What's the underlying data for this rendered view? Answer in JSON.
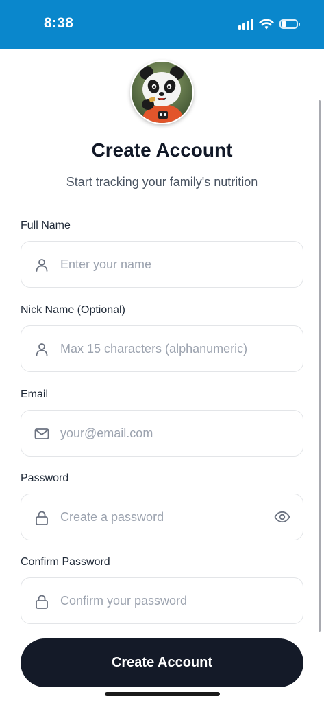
{
  "status_bar": {
    "time": "8:38",
    "icons": [
      "cellular-signal-icon",
      "wifi-icon",
      "battery-icon"
    ],
    "battery_level": 0.35,
    "background_color": "#0a87cc"
  },
  "header": {
    "avatar_icon": "panda-avatar-icon",
    "title": "Create Account",
    "subtitle": "Start tracking your family's nutrition"
  },
  "form": {
    "full_name": {
      "label": "Full Name",
      "placeholder": "Enter your name",
      "value": "",
      "icon": "user-icon"
    },
    "nick_name": {
      "label": "Nick Name (Optional)",
      "placeholder": "Max 15 characters (alphanumeric)",
      "value": "",
      "icon": "user-icon"
    },
    "email": {
      "label": "Email",
      "placeholder": "your@email.com",
      "value": "",
      "icon": "mail-icon"
    },
    "password": {
      "label": "Password",
      "placeholder": "Create a password",
      "value": "",
      "icon": "lock-icon",
      "toggle_icon": "eye-icon"
    },
    "confirm_password": {
      "label": "Confirm Password",
      "placeholder": "Confirm your password",
      "value": "",
      "icon": "lock-icon"
    }
  },
  "actions": {
    "submit_label": "Create Account",
    "submit_color": "#141a28"
  }
}
